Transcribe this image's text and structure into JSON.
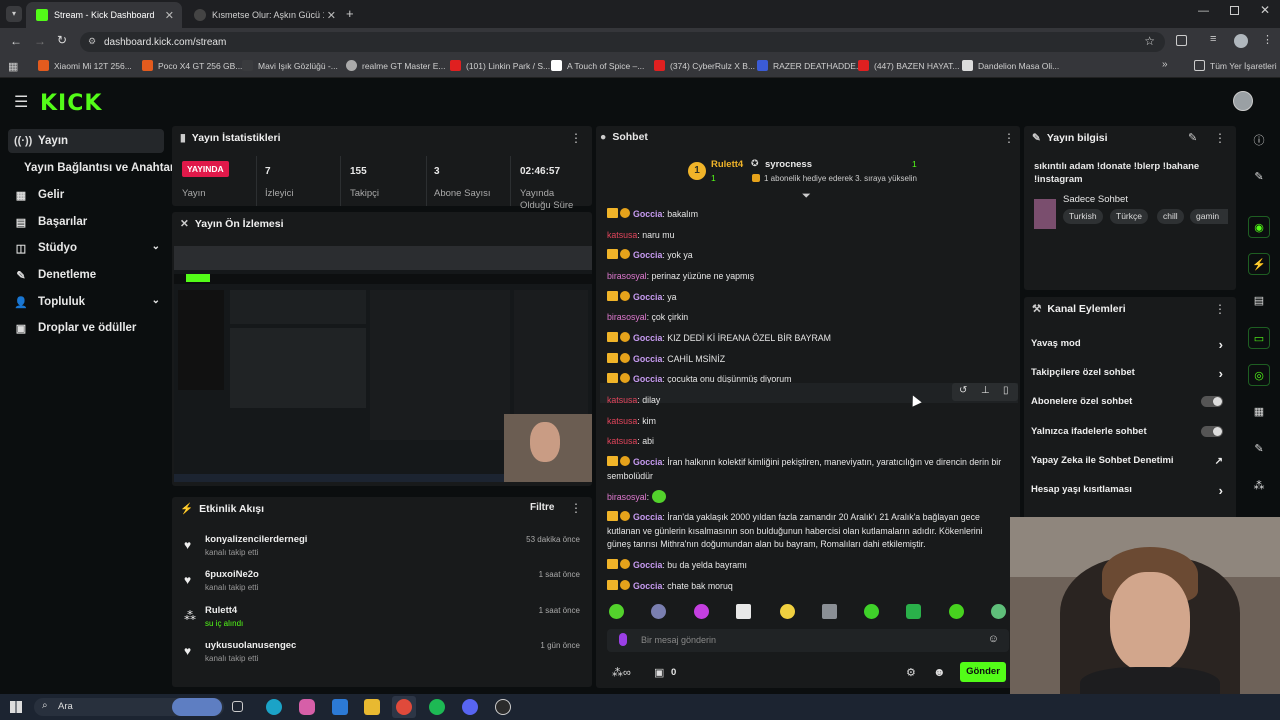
{
  "browser": {
    "tab1": "Stream - Kick Dashboard",
    "tab2": "Kısmetse Olur: Aşkın Gücü 1. Se",
    "url": "dashboard.kick.com/stream",
    "bookmarks": [
      "Xiaomi Mi 12T 256...",
      "Poco X4 GT 256 GB...",
      "Mavi Işık Gözlüğü -...",
      "realme GT Master E...",
      "(101) Linkin Park / S...",
      "A Touch of Spice –...",
      "(374) CyberRulz X B...",
      "RAZER DEATHADDE...",
      "(447) BAZEN HAYAT...",
      "Dandelion Masa Oli..."
    ],
    "all_bookmarks": "Tüm Yer İşaretleri"
  },
  "sidebar": {
    "items": [
      "Yayın",
      "Yayın Bağlantısı ve Anahtarı",
      "Gelir",
      "Başarılar",
      "Stüdyo",
      "Denetleme",
      "Topluluk",
      "Droplar ve ödüller"
    ]
  },
  "logo": "KICK",
  "stats": {
    "title": "Yayın İstatistikleri",
    "live": "YAYINDA",
    "live_label": "Yayın",
    "viewers": "7",
    "viewers_label": "İzleyici",
    "followers": "155",
    "followers_label": "Takipçi",
    "subs": "3",
    "subs_label": "Abone Sayısı",
    "uptime": "02:46:57",
    "uptime_label": "Yayında Olduğu Süre"
  },
  "preview": {
    "title": "Yayın Ön İzlemesi"
  },
  "activity": {
    "title": "Etkinlik Akışı",
    "filter": "Filtre",
    "items": [
      {
        "name": "konyalizencilerdernegi",
        "sub": "kanalı takip etti",
        "time": "53 dakika önce"
      },
      {
        "name": "6puxoiNe2o",
        "sub": "kanalı takip etti",
        "time": "1 saat önce"
      },
      {
        "name": "Rulett4",
        "sub": "su iç alındı",
        "time": "1 saat önce"
      },
      {
        "name": "uykusuolanusengec",
        "sub": "kanalı takip etti",
        "time": "1 gün önce"
      }
    ]
  },
  "chat": {
    "title": "Sohbet",
    "pin_user": "Rulett4",
    "pin_user_count": "1",
    "pin_target": "syrocness",
    "pin_count": "1",
    "pin_text": "1 abonelik hediye ederek 3. sıraya yükselin",
    "messages": [
      {
        "u": "Goccia",
        "t": "bakalım"
      },
      {
        "u": "katsusa",
        "t": "naru mu"
      },
      {
        "u": "Goccia",
        "t": "yok ya"
      },
      {
        "u": "birasosyal",
        "t": "perinaz yüzüne ne yapmış"
      },
      {
        "u": "Goccia",
        "t": "ya"
      },
      {
        "u": "birasosyal",
        "t": "çok çirkin"
      },
      {
        "u": "Goccia",
        "t": "KIZ DEDİ Kİ İREANA ÖZEL BİR BAYRAM"
      },
      {
        "u": "Goccia",
        "t": "CAHİL MSİNİZ"
      },
      {
        "u": "Goccia",
        "t": "çocukta onu düşünmüş diyorum"
      },
      {
        "u": "katsusa",
        "t": "dilay"
      },
      {
        "u": "katsusa",
        "t": "kim"
      },
      {
        "u": "katsusa",
        "t": "abi"
      },
      {
        "u": "Goccia",
        "t": "İran halkının kolektif kimliğini pekiştiren, maneviyatın, yaratıcılığın ve direncin derin bir sembolüdür"
      },
      {
        "u": "birasosyal",
        "t": ""
      },
      {
        "u": "Goccia",
        "t": "İran'da yaklaşık 2000 yıldan fazla zamandır 20 Aralık'ı 21 Aralık'a bağlayan gece kutlanan ve günlerin kısalmasının son bulduğunun habercisi olan kutlamaların adıdır. Kökenlerini güneş tanrısı Mithra'nın doğumundan alan bu bayram, Romalıları dahi etkilemiştir."
      },
      {
        "u": "Goccia",
        "t": "bu da yelda bayramı"
      },
      {
        "u": "Goccia",
        "t": "chate bak moruq"
      }
    ],
    "placeholder": "Bir mesaj gönderin",
    "send": "Gönder",
    "count": "0"
  },
  "info": {
    "title": "Yayın bilgisi",
    "stream_title": "sıkıntılı adam !donate !blerp !bahane !instagram",
    "category": "Sadece Sohbet",
    "tags": [
      "Turkish",
      "Türkçe",
      "chill",
      "gamin"
    ]
  },
  "channel": {
    "title": "Kanal Eylemleri",
    "items": [
      "Yavaş mod",
      "Takipçilere özel sohbet",
      "Abonelere özel sohbet",
      "Yalnızca ifadelerle sohbet",
      "Yapay Zeka ile Sohbet Denetimi",
      "Hesap yaşı kısıtlaması"
    ]
  },
  "taskbar": {
    "search": "Ara"
  },
  "colors": {
    "accent": "#53fc18",
    "live": "#e0194a",
    "bg": "#0b0e0f",
    "panel": "#181a1b"
  }
}
